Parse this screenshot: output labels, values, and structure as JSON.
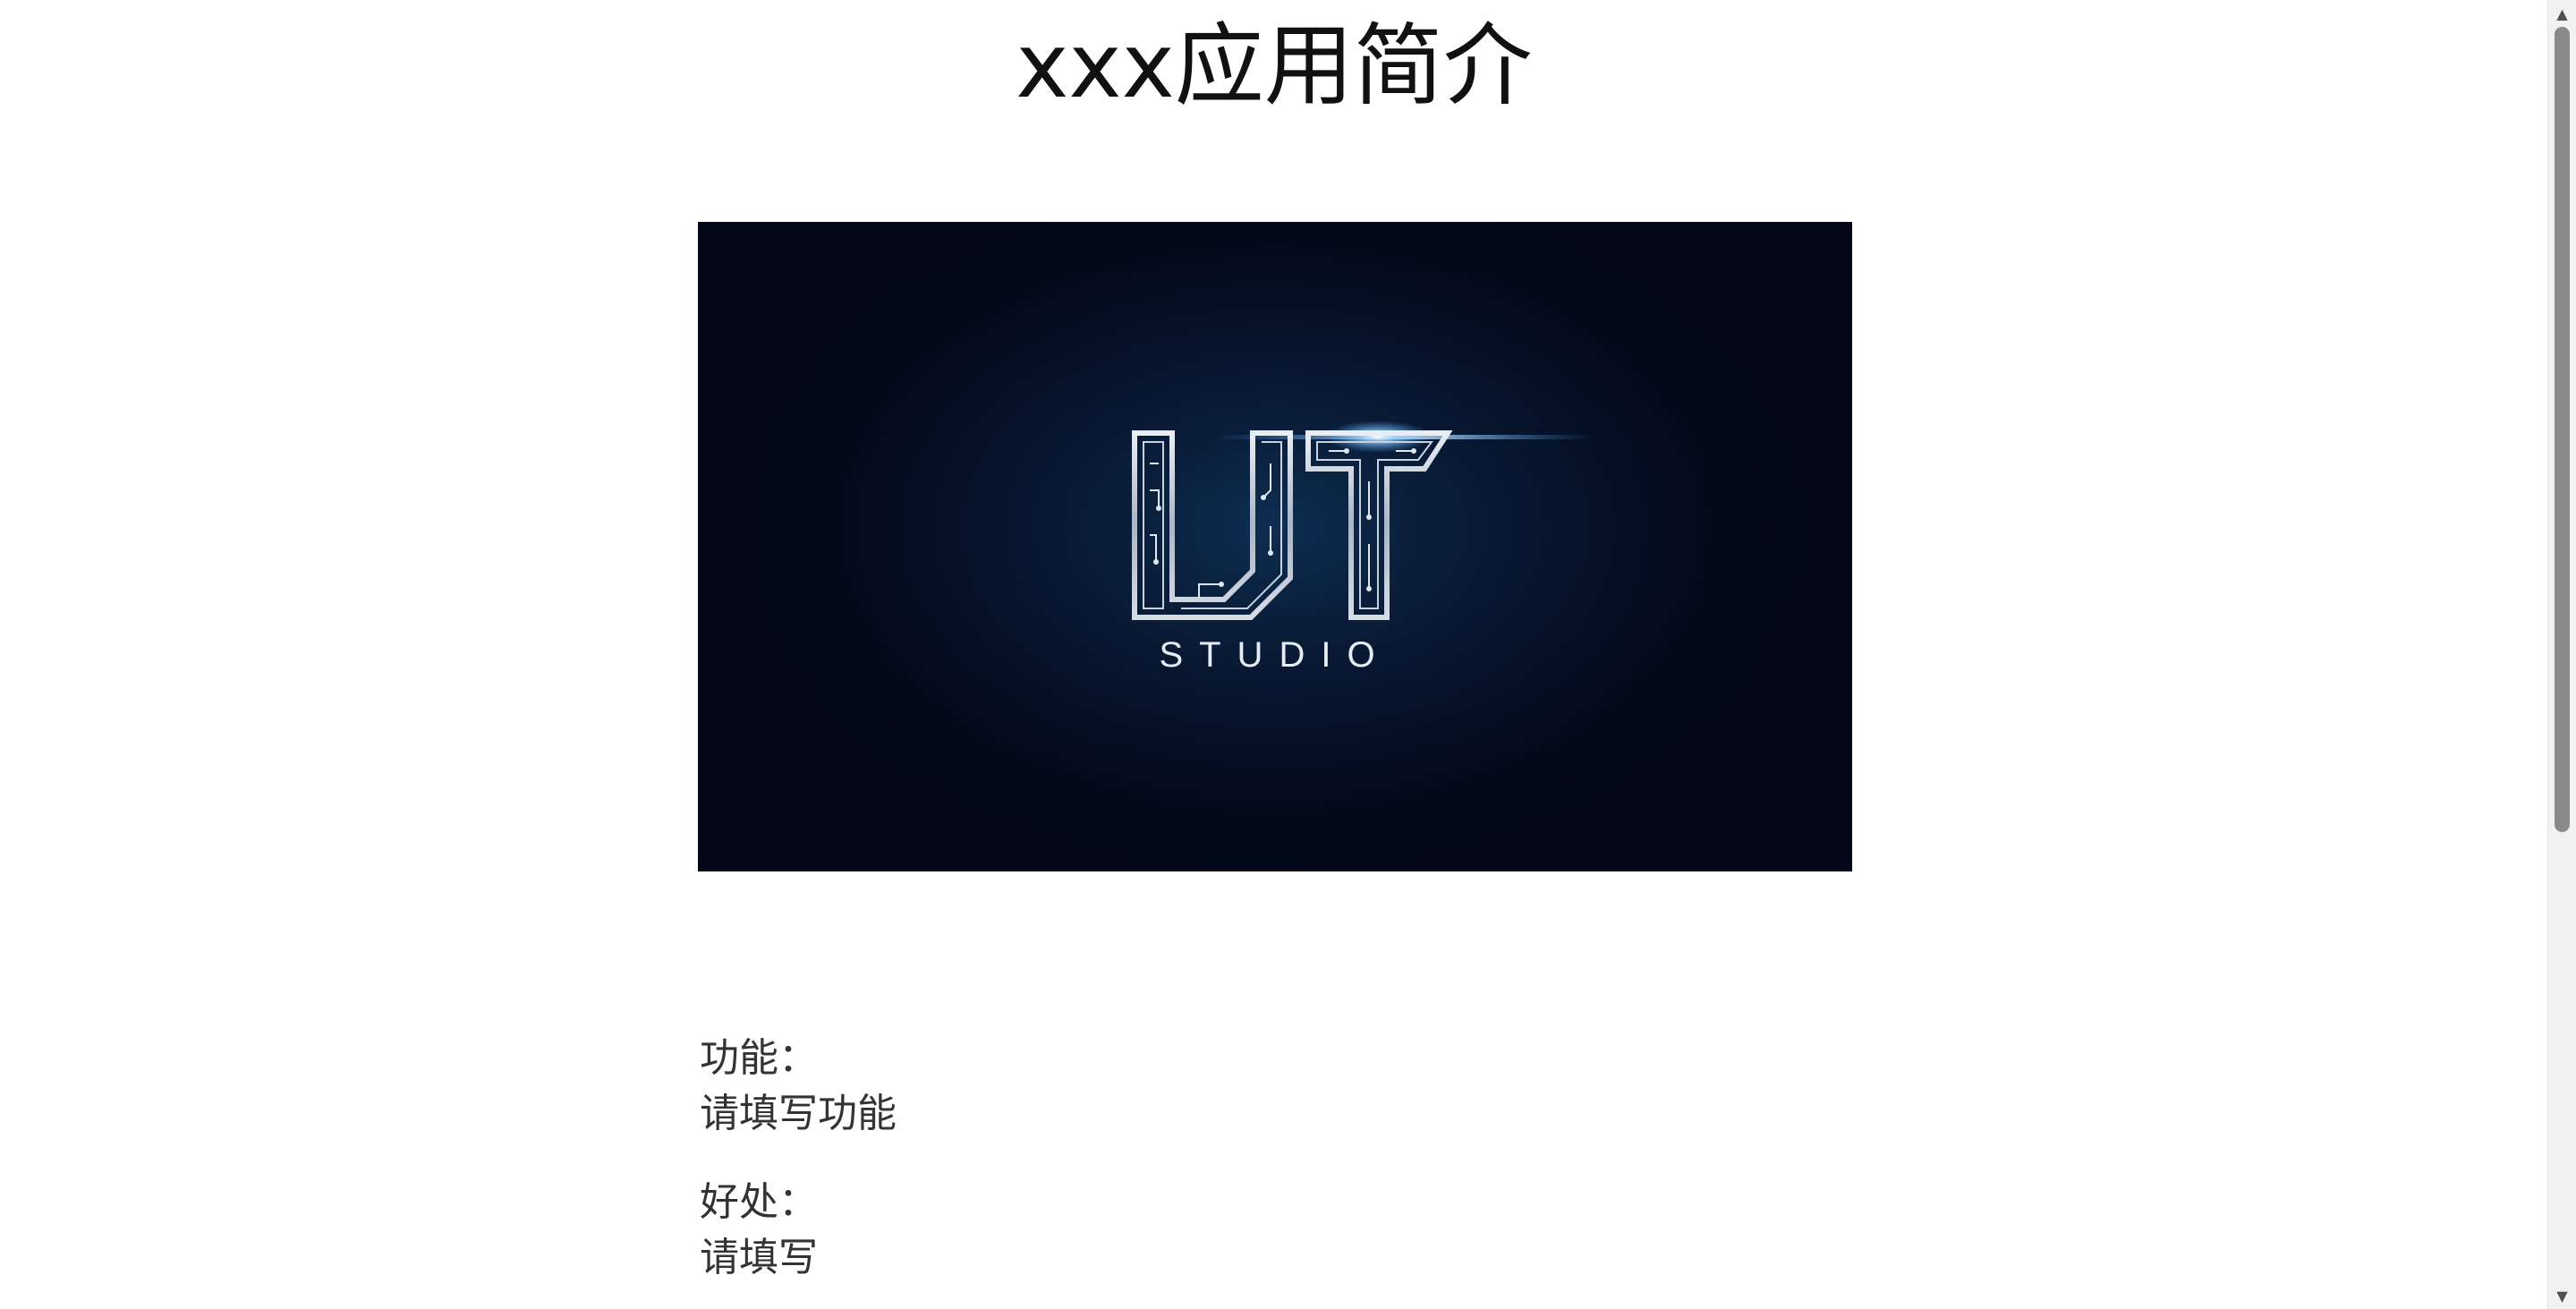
{
  "page": {
    "title": "xxx应用简介"
  },
  "hero": {
    "logo_text": "UT",
    "logo_subtitle": "STUDIO",
    "background_color": "#061229",
    "accent_color": "#4aa8ff"
  },
  "sections": [
    {
      "heading": "功能：",
      "body": "请填写功能"
    },
    {
      "heading": "好处：",
      "body": "请填写"
    }
  ],
  "scrollbar": {
    "up_icon": "▲",
    "down_icon": "▼"
  }
}
